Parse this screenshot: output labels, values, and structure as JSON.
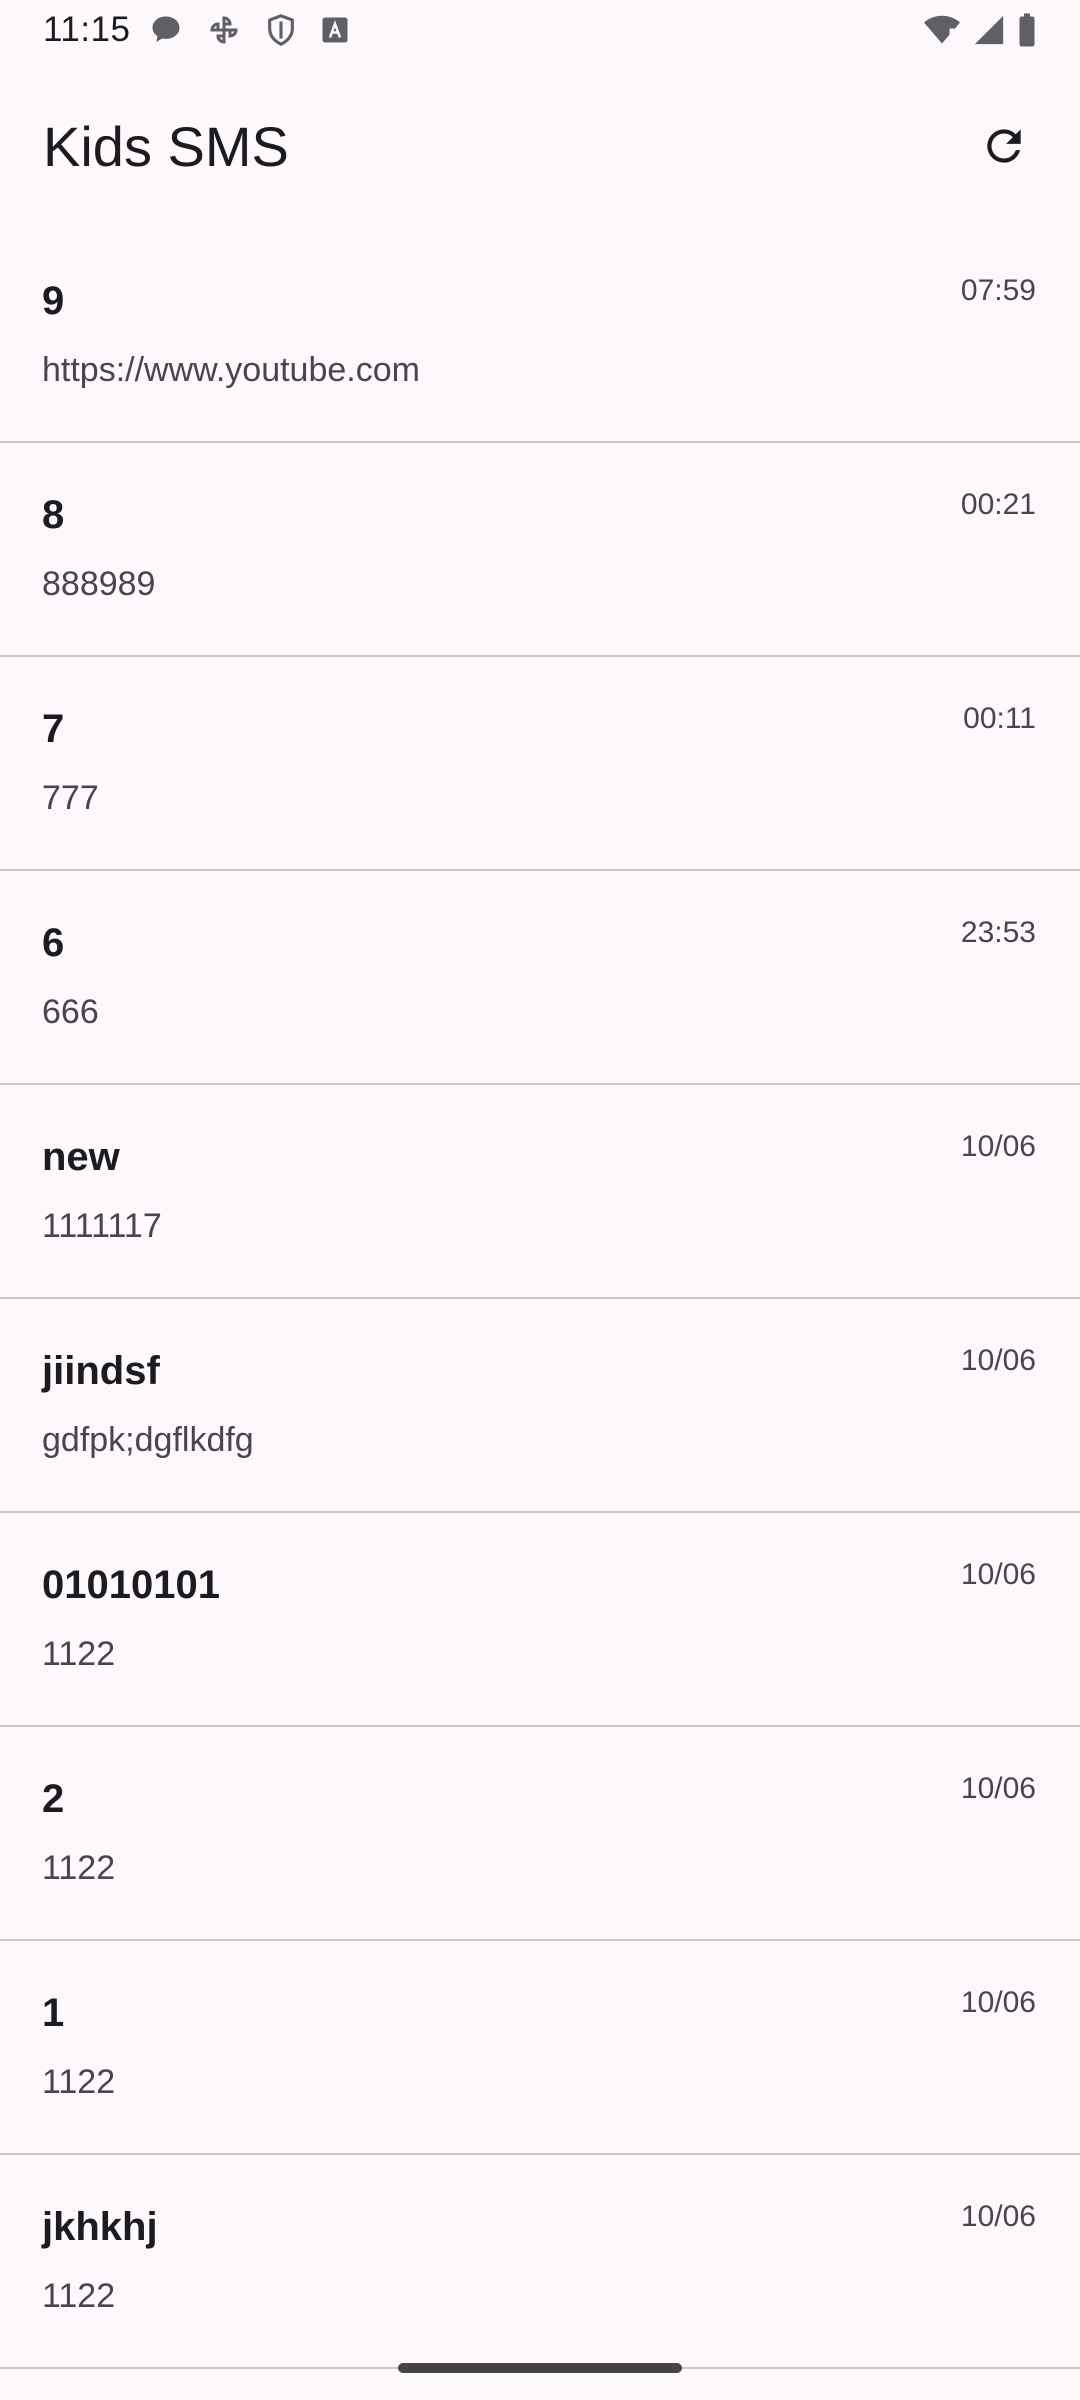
{
  "status_bar": {
    "time": "11:15",
    "left_icons": [
      "chat-bubble-icon",
      "pinwheel-icon",
      "shield-icon",
      "text-a-icon"
    ],
    "right_icons": [
      "wifi-alert-icon",
      "cell-signal-icon",
      "battery-icon"
    ]
  },
  "app_bar": {
    "title": "Kids SMS",
    "refresh_icon": "refresh-icon"
  },
  "messages": [
    {
      "sender": "9",
      "body": "https://www.youtube.com",
      "time": "07:59"
    },
    {
      "sender": "8",
      "body": "888989",
      "time": "00:21"
    },
    {
      "sender": "7",
      "body": "777",
      "time": "00:11"
    },
    {
      "sender": "6",
      "body": "666",
      "time": "23:53"
    },
    {
      "sender": "new",
      "body": "1111117",
      "time": "10/06"
    },
    {
      "sender": "jiindsf",
      "body": "gdfpk;dgflkdfg",
      "time": "10/06"
    },
    {
      "sender": "01010101",
      "body": "1122",
      "time": "10/06"
    },
    {
      "sender": "2",
      "body": "1122",
      "time": "10/06"
    },
    {
      "sender": "1",
      "body": "1122",
      "time": "10/06"
    },
    {
      "sender": "jkhkhj",
      "body": "1122",
      "time": "10/06"
    }
  ],
  "colors": {
    "background": "#fdf8fc",
    "divider": "#c9c5ca",
    "text_primary": "#1c1b1f",
    "text_secondary": "#49454f"
  }
}
